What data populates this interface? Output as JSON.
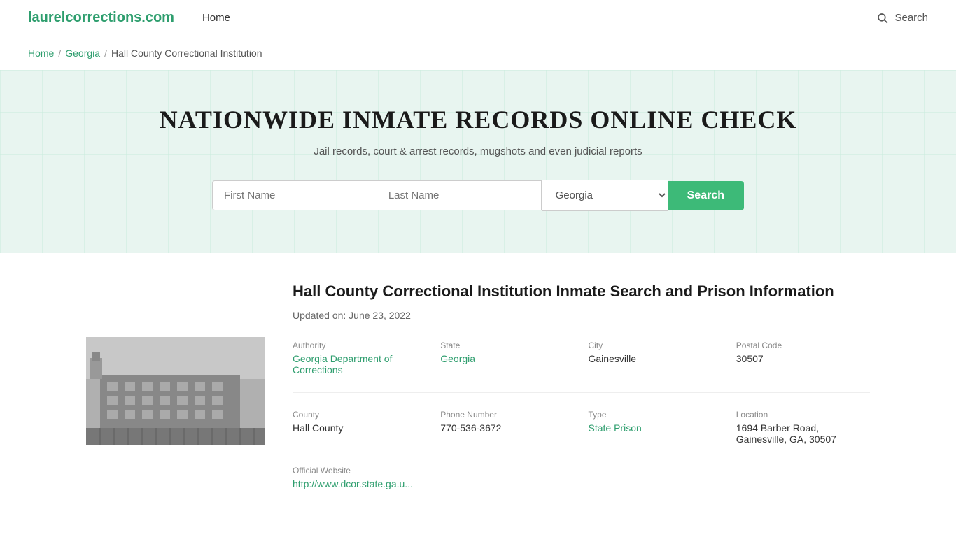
{
  "header": {
    "site_title": "laurelcorrections.com",
    "nav_home": "Home",
    "search_label": "Search"
  },
  "breadcrumb": {
    "home": "Home",
    "state": "Georgia",
    "current": "Hall County Correctional Institution"
  },
  "hero": {
    "title": "NATIONWIDE INMATE RECORDS ONLINE CHECK",
    "subtitle": "Jail records, court & arrest records, mugshots and even judicial reports",
    "first_name_placeholder": "First Name",
    "last_name_placeholder": "Last Name",
    "state_default": "Georgia",
    "search_button": "Search"
  },
  "facility": {
    "title": "Hall County Correctional Institution Inmate Search and Prison Information",
    "updated": "Updated on: June 23, 2022",
    "authority_label": "Authority",
    "authority_value": "Georgia Department of Corrections",
    "state_label": "State",
    "state_value": "Georgia",
    "city_label": "City",
    "city_value": "Gainesville",
    "postal_code_label": "Postal Code",
    "postal_code_value": "30507",
    "county_label": "County",
    "county_value": "Hall County",
    "phone_label": "Phone Number",
    "phone_value": "770-536-3672",
    "type_label": "Type",
    "type_value": "State Prison",
    "location_label": "Location",
    "location_value": "1694 Barber Road, Gainesville, GA, 30507",
    "official_website_label": "Official Website",
    "official_website_value": "http://www.dcor.state.ga.u..."
  }
}
